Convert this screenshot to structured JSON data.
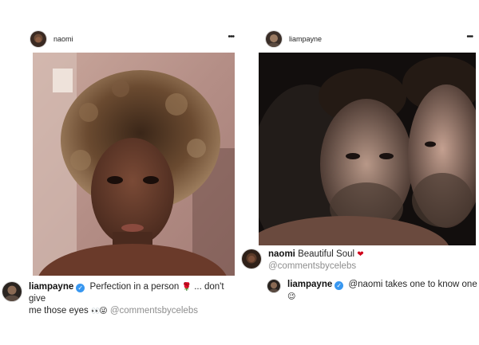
{
  "left_post": {
    "username": "naomi",
    "avatar_icon": "profile-photo-icon",
    "menu_icon": "more-options-icon",
    "menu_glyph": "•••",
    "photo_description_icon": "selfie-photo",
    "comment": {
      "username": "liampayne",
      "text_part1": "Perfection in a person",
      "rose_emoji": "🌹",
      "text_part2": "... don't give",
      "text_part3": "me those eyes",
      "eyes_emoji": "👀",
      "wink_emoji": "😜",
      "handle": "@commentsbycelebs"
    }
  },
  "right_post": {
    "username": "liampayne",
    "menu_glyph": "•••",
    "comment1": {
      "username": "naomi",
      "text": "Beautiful Soul",
      "heart_emoji": "❤",
      "handle": "@commentsbycelebs"
    },
    "comment2": {
      "username": "liampayne",
      "text": "@naomi takes one to know one",
      "emoji": "😉"
    }
  },
  "colors": {
    "verified": "#3897f0",
    "text": "#262626",
    "handle": "#8e8e8e",
    "heart": "#d0021b"
  }
}
